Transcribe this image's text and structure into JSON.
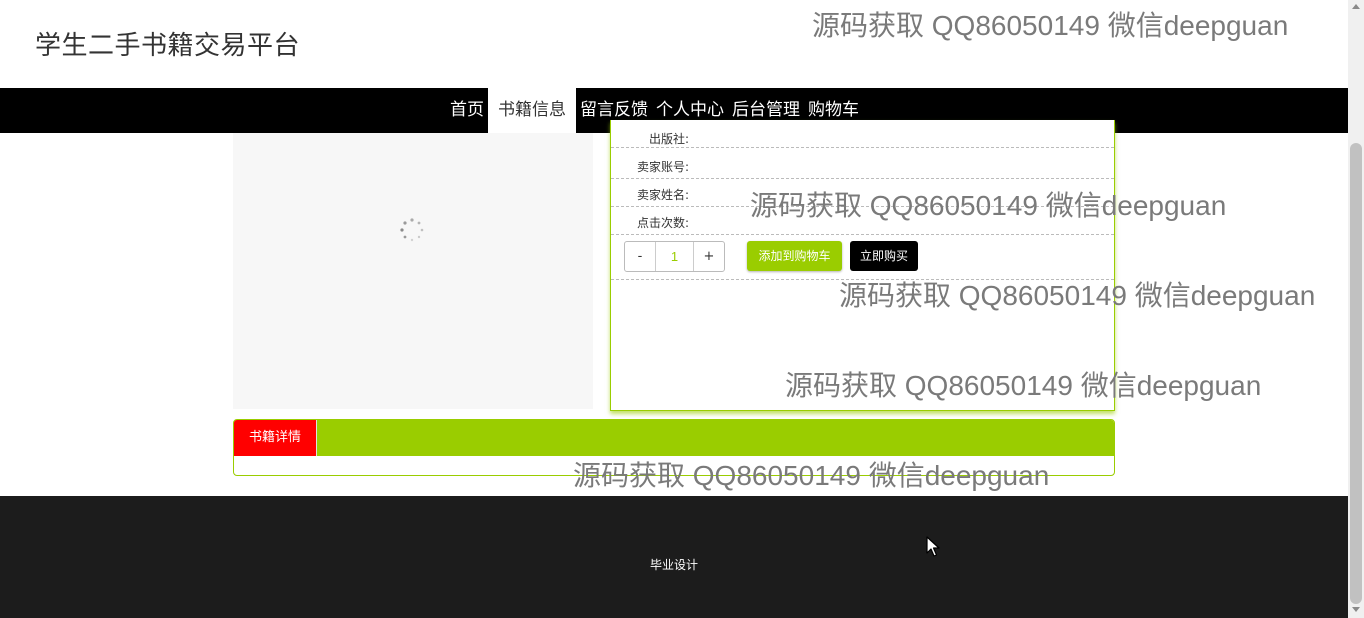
{
  "header": {
    "title": "学生二手书籍交易平台"
  },
  "nav": {
    "items": [
      {
        "label": "首页"
      },
      {
        "label": "书籍信息"
      },
      {
        "label": "留言反馈"
      },
      {
        "label": "个人中心"
      },
      {
        "label": "后台管理"
      },
      {
        "label": "购物车"
      }
    ],
    "active_item": "书籍信息"
  },
  "product": {
    "fields": [
      {
        "label": "出版社:",
        "value": ""
      },
      {
        "label": "卖家账号:",
        "value": ""
      },
      {
        "label": "卖家姓名:",
        "value": ""
      },
      {
        "label": "点击次数:",
        "value": ""
      }
    ],
    "quantity": {
      "minus_label": "-",
      "value": "1",
      "plus_label": "+"
    },
    "add_to_cart_label": "添加到购物车",
    "buy_now_label": "立即购买"
  },
  "detail": {
    "tab_label": "书籍详情"
  },
  "footer": {
    "text": "毕业设计"
  },
  "watermark": {
    "text": "源码获取 QQ86050149 微信deepguan"
  },
  "colors": {
    "accent": "#9acd00",
    "tab_active": "#ff0000",
    "navbar": "#000000",
    "footer": "#1c1c1c"
  },
  "icons": [
    "loading-spinner-icon",
    "mouse-cursor-icon"
  ]
}
